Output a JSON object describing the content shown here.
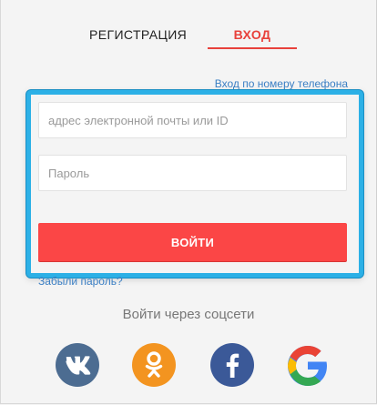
{
  "tabs": {
    "register_label": "РЕГИСТРАЦИЯ",
    "login_label": "ВХОД"
  },
  "form": {
    "phone_link": "Вход по номеру телефона",
    "email_placeholder": "адрес электронной почты или ID",
    "password_placeholder": "Пароль",
    "submit_label": "ВОЙТИ",
    "forgot_link": "Забыли пароль?"
  },
  "social": {
    "title": "Войти через соцсети",
    "providers": [
      {
        "name": "vk-icon",
        "color": "#4c6c91"
      },
      {
        "name": "odnoklassniki-icon",
        "color": "#f39420"
      },
      {
        "name": "facebook-icon",
        "color": "#3b5998"
      },
      {
        "name": "google-icon",
        "color": "#4285f4"
      }
    ]
  },
  "colors": {
    "accent": "#e8413b",
    "button": "#fb4646",
    "link": "#3b7fc4",
    "highlight": "#2cb0e6"
  }
}
